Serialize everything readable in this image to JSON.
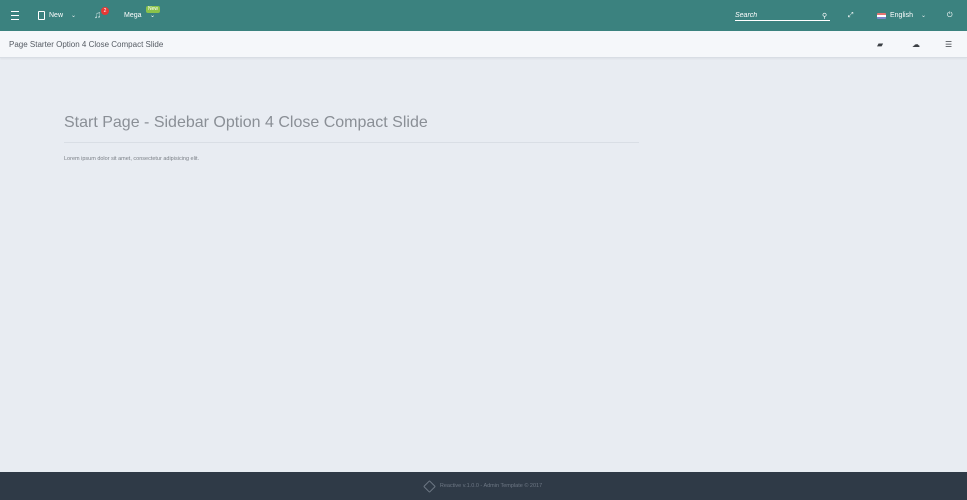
{
  "topbar": {
    "menu_icon": "hamburger-icon",
    "new_label": "New",
    "notification_count": "2",
    "mega_label": "Mega",
    "mega_badge": "New",
    "search_placeholder": "Search",
    "language": "English",
    "accent_color": "#3b827f"
  },
  "subbar": {
    "breadcrumb": "Page Starter Option 4 Close Compact Slide",
    "actions": [
      "book-icon",
      "cloud-upload-icon",
      "sliders-icon"
    ]
  },
  "main": {
    "heading": "Start Page - Sidebar Option 4 Close Compact Slide",
    "body_text": "Lorem ipsum dolor sit amet, consectetur adipisicing elit."
  },
  "footer": {
    "text": "Reactive v.1.0.0 - Admin Template © 2017",
    "icon": "layers-icon"
  }
}
